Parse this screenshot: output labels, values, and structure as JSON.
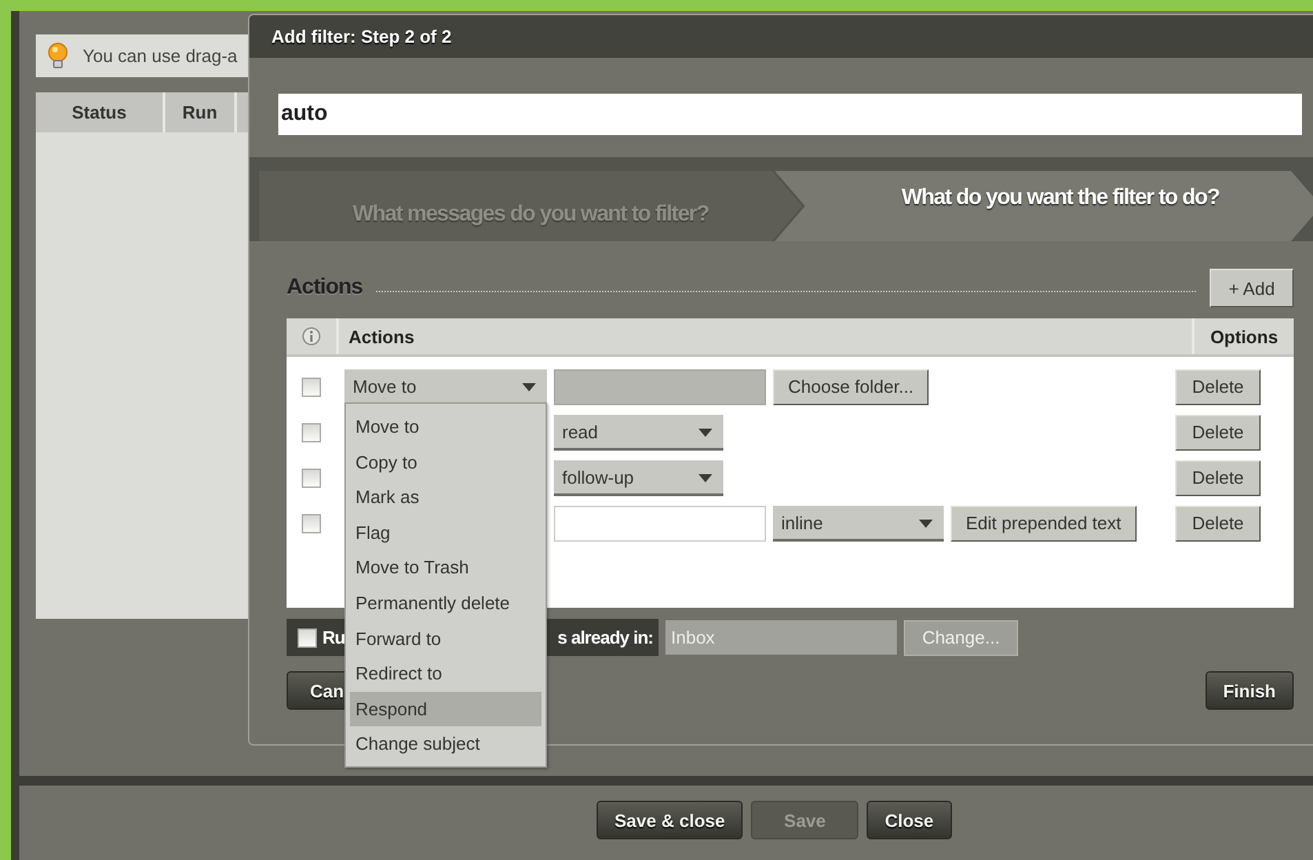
{
  "background": {
    "tip": "You can use drag-a",
    "columns": [
      "Status",
      "Run"
    ]
  },
  "dialog": {
    "title": "Add filter: Step 2 of 2",
    "name_value": "auto",
    "steps": [
      {
        "label": "What messages do you want to filter?",
        "selected": false
      },
      {
        "label": "What do you want the filter to do?",
        "selected": true
      }
    ],
    "section_title": "Actions",
    "add_button": "+ Add",
    "table": {
      "columns": [
        "Actions",
        "Options"
      ],
      "rows": [
        {
          "checked": false,
          "action": {
            "kind": "select",
            "value": "Move to"
          },
          "controls": [
            {
              "kind": "field",
              "disabled": true
            },
            {
              "kind": "button",
              "label": "Choose folder..."
            }
          ],
          "delete": "Delete"
        },
        {
          "checked": false,
          "controls": [
            {
              "kind": "select",
              "value": "read"
            }
          ],
          "delete": "Delete"
        },
        {
          "checked": false,
          "controls": [
            {
              "kind": "select",
              "value": "follow-up"
            }
          ],
          "delete": "Delete"
        },
        {
          "checked": false,
          "controls": [
            {
              "kind": "field",
              "disabled": false
            },
            {
              "kind": "select",
              "value": "inline"
            },
            {
              "kind": "button",
              "label": "Edit prepended text"
            }
          ],
          "delete": "Delete"
        }
      ]
    },
    "run_existing": {
      "checked": false,
      "label_parts": [
        "Ru",
        "s already in:"
      ],
      "folder": "Inbox",
      "change_button": "Change...",
      "disabled": true
    },
    "cancel_button": "Can",
    "finish_button": "Finish"
  },
  "menu": {
    "items": [
      {
        "label": "Move to",
        "selected": false
      },
      {
        "label": "Copy to",
        "selected": false
      },
      {
        "label": "Mark as",
        "selected": false
      },
      {
        "label": "Flag",
        "selected": false
      },
      {
        "label": "Move to Trash",
        "selected": false
      },
      {
        "label": "Permanently delete",
        "selected": false
      },
      {
        "label": "Forward to",
        "selected": false
      },
      {
        "label": "Redirect to",
        "selected": false
      },
      {
        "label": "Respond",
        "selected": true
      },
      {
        "label": "Change subject",
        "selected": false
      }
    ]
  },
  "footer": {
    "buttons": [
      {
        "label": "Save & close",
        "disabled": false
      },
      {
        "label": "Save",
        "disabled": true
      },
      {
        "label": "Close",
        "disabled": false
      }
    ]
  }
}
